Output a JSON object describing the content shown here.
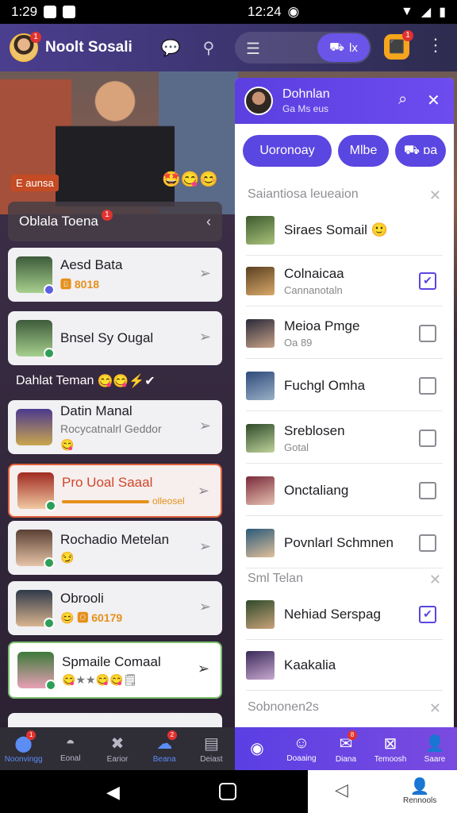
{
  "status": {
    "time": "1:29",
    "center_time": "12:24"
  },
  "appbar": {
    "title": "Noolt Sosali",
    "avatar_badge": "1",
    "account_label": "lx",
    "notif_badge": "1"
  },
  "scene": {
    "label": "E aunsa",
    "emojis": "🤩😋😊"
  },
  "left": {
    "head1": "Oblala Toena",
    "head1_badge": "1",
    "cards_a": [
      {
        "name": "Aesd Bata",
        "sub": "🅱 8018",
        "style": "amber"
      },
      {
        "name": "Bnsel Sy Ougal",
        "sub": ""
      }
    ],
    "head2": "Dahlat Teman",
    "head2_emojis": "😋😋⚡✔",
    "cards_b": [
      {
        "name": "Datin Manal",
        "sub": "Rocycatnalrl Geddor",
        "extra": "😋"
      },
      {
        "name": "Pro Uoal Saaal",
        "sub": "olleosel",
        "active": true
      },
      {
        "name": "Rochadio Metelan",
        "sub": "😏"
      },
      {
        "name": "Obrooli",
        "sub": "😊 🅾 60179"
      },
      {
        "name": "Spmaile Comaal",
        "sub": "😋★★😋😋🗒"
      }
    ]
  },
  "panel": {
    "name": "Dohnlan",
    "sub": "Ga Ms eus",
    "chips": [
      "Uoronoay",
      "Mlbe",
      "ɒa"
    ],
    "group1": "Saiantiosa leueaion",
    "rows1": [
      {
        "name": "Siraes Somail",
        "sub": "🙂",
        "check": false,
        "showcb": false
      },
      {
        "name": "Colnaicaa",
        "sub": "Cannanotaln",
        "check": true,
        "showcb": true
      },
      {
        "name": "Meioa Pmge",
        "sub": "Oa 89",
        "check": false,
        "showcb": true
      },
      {
        "name": "Fuchgl Omha",
        "sub": "",
        "check": false,
        "showcb": true
      },
      {
        "name": "Sreblosen",
        "sub": "Gotal",
        "check": false,
        "showcb": true
      },
      {
        "name": "Onctaliang",
        "sub": "",
        "check": false,
        "showcb": true
      },
      {
        "name": "Povnlarl Schmnen",
        "sub": "",
        "check": false,
        "showcb": true
      }
    ],
    "group2": "Sml Telan",
    "rows2": [
      {
        "name": "Nehiad Serspag",
        "sub": "",
        "check": true,
        "showcb": true
      },
      {
        "name": "Kaakalia",
        "sub": "",
        "check": false,
        "showcb": false
      }
    ],
    "group3": "Sobnonen2s"
  },
  "nav_left": [
    {
      "label": "Noonvingg",
      "icon": "home-icon",
      "badge": "1",
      "selected": true
    },
    {
      "label": "Eonal",
      "icon": "game-icon",
      "badge": ""
    },
    {
      "label": "Earior",
      "icon": "tools-icon",
      "badge": ""
    },
    {
      "label": "Beana",
      "icon": "chat-icon",
      "badge": "2",
      "selected": true
    },
    {
      "label": "Deiast",
      "icon": "grid-icon",
      "badge": ""
    }
  ],
  "nav_right": [
    {
      "label": "",
      "icon": "avatar-icon",
      "badge": ""
    },
    {
      "label": "Doaaing",
      "icon": "profile-icon",
      "badge": ""
    },
    {
      "label": "Diana",
      "icon": "mail-icon",
      "badge": "8"
    },
    {
      "label": "Temoosh",
      "icon": "box-icon",
      "badge": ""
    },
    {
      "label": "Saare",
      "icon": "person-icon",
      "badge": ""
    }
  ],
  "sysnav": {
    "sheet_label": "Rennools"
  }
}
